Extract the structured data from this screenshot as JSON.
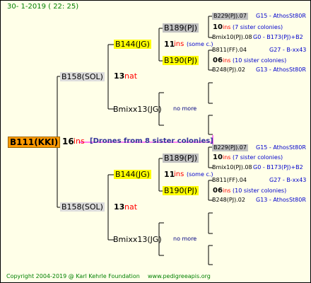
{
  "header": {
    "date": "30-   1-2019  (  22:  25)"
  },
  "root": {
    "id": "B111(KKI)",
    "gen": "16",
    "ins": "ins",
    "desc": "[Drones from 8 sister colonies]"
  },
  "upper": {
    "mid": {
      "id": "B158(SOL)",
      "num": "13",
      "tag": "nat"
    },
    "queen": {
      "id": "B144(JG)",
      "num": "11",
      "ins": "ins",
      "note": "(some c.)"
    },
    "f1": {
      "id": "B189(PJ)"
    },
    "f2": {
      "id": "B190(PJ)"
    },
    "r1": {
      "id": "B229(PJ).07",
      "note": "G15 - AthosSt80R"
    },
    "r2": {
      "num": "10",
      "ins": "ins",
      "note": "(7 sister colonies)"
    },
    "r3": {
      "id": "Bmix10(PJ).08",
      "note": "G0 - B173(PJ)+B2"
    },
    "r4": {
      "id": "B811(FF).04",
      "note": "G27 - B-xx43"
    },
    "r5": {
      "num": "06",
      "ins": "ins",
      "note": "(10 sister colonies)"
    },
    "r6": {
      "id": "B248(PJ).02",
      "note": "G13 - AthosSt80R"
    },
    "mix": {
      "id": "Bmixx13(JG)",
      "note": "no more"
    }
  },
  "lower": {
    "mid": {
      "id": "B158(SOL)",
      "num": "13",
      "tag": "nat"
    },
    "queen": {
      "id": "B144(JG)",
      "num": "11",
      "ins": "ins",
      "note": "(some c.)"
    },
    "f1": {
      "id": "B189(PJ)"
    },
    "f2": {
      "id": "B190(PJ)"
    },
    "r1": {
      "id": "B229(PJ).07",
      "note": "G15 - AthosSt80R"
    },
    "r2": {
      "num": "10",
      "ins": "ins",
      "note": "(7 sister colonies)"
    },
    "r3": {
      "id": "Bmix10(PJ).08",
      "note": "G0 - B173(PJ)+B2"
    },
    "r4": {
      "id": "B811(FF).04",
      "note": "G27 - B-xx43"
    },
    "r5": {
      "num": "06",
      "ins": "ins",
      "note": "(10 sister colonies)"
    },
    "r6": {
      "id": "B248(PJ).02",
      "note": "G13 - AthosSt80R"
    },
    "mix": {
      "id": "Bmixx13(JG)",
      "note": "no more"
    }
  },
  "footer": {
    "copyright": "Copyright 2004-2019 @ Karl Kehrle Foundation",
    "url": "www.pedigreeapis.org"
  }
}
